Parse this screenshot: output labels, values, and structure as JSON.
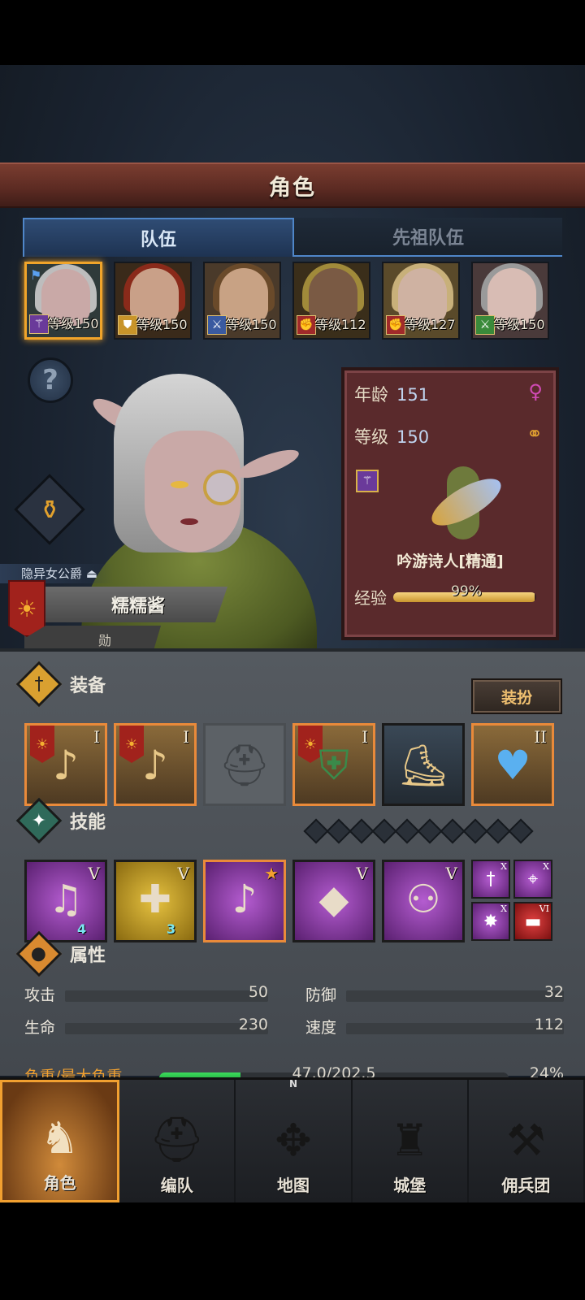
{
  "header": {
    "title": "角色"
  },
  "tabs": [
    {
      "label": "队伍",
      "active": true
    },
    {
      "label": "先祖队伍",
      "active": false
    }
  ],
  "party": [
    {
      "level_text": "等级150",
      "class_color": "#6a3a9a",
      "class_icon": "wand-icon",
      "hair": "#bdbdbd",
      "skin": "#c9a9a7",
      "bg": "#2f3a3a",
      "selected": true
    },
    {
      "level_text": "等级150",
      "class_color": "#c8942a",
      "class_icon": "shield-icon",
      "hair": "#8a2a1a",
      "skin": "#c9a088",
      "bg": "#3a2a1a",
      "selected": false
    },
    {
      "level_text": "等级150",
      "class_color": "#3a5aa0",
      "class_icon": "sword-icon",
      "hair": "#6a4a2a",
      "skin": "#c8a284",
      "bg": "#4a3a2a",
      "selected": false
    },
    {
      "level_text": "等级112",
      "class_color": "#a02a2a",
      "class_icon": "fist-icon",
      "hair": "#a08a3a",
      "skin": "#7a5a44",
      "bg": "#3a2e1a",
      "selected": false
    },
    {
      "level_text": "等级127",
      "class_color": "#a02a2a",
      "class_icon": "fist-icon",
      "hair": "#c8b07a",
      "skin": "#cfb2a2",
      "bg": "#5a4a2a",
      "selected": false
    },
    {
      "level_text": "等级150",
      "class_color": "#3a8a3a",
      "class_icon": "crossed-swords-icon",
      "hair": "#9a9a9a",
      "skin": "#d8bcb4",
      "bg": "#4a3a3a",
      "selected": false
    }
  ],
  "hero": {
    "title_tag": "隐异女公爵",
    "name": "糯糯酱",
    "sub_label": "勋",
    "age_label": "年龄",
    "age": "151",
    "level_label": "等级",
    "level": "150",
    "class_name": "吟游诗人[精通]",
    "exp_label": "经验",
    "exp_text": "99%",
    "exp_fraction": 0.99,
    "gender_icon": "female-icon",
    "status_icon": "rings-icon"
  },
  "equipment": {
    "title": "装备",
    "dress_button": "装扮",
    "slots": [
      {
        "tier": "I",
        "type": "orange",
        "icon": "lute-icon"
      },
      {
        "tier": "I",
        "type": "orange",
        "icon": "lute-icon"
      },
      {
        "tier": "",
        "type": "empty",
        "icon": "helmet-icon"
      },
      {
        "tier": "I",
        "type": "orange",
        "icon": "armor-icon"
      },
      {
        "tier": "",
        "type": "dark",
        "icon": "boots-icon"
      },
      {
        "tier": "II",
        "type": "orange",
        "icon": "amulet-icon"
      }
    ]
  },
  "skills": {
    "title": "技能",
    "gems_count": 10,
    "items": [
      {
        "tier": "V",
        "badge": "4",
        "style": "purple",
        "icon": "music-note-icon"
      },
      {
        "tier": "V",
        "badge": "3",
        "style": "gold",
        "icon": "shield-heal-icon"
      },
      {
        "tier": "★",
        "badge": "",
        "style": "purple-orange",
        "icon": "crystal-note-icon"
      },
      {
        "tier": "V",
        "badge": "",
        "style": "purple",
        "icon": "crystal-figure-icon"
      },
      {
        "tier": "V",
        "badge": "",
        "style": "purple",
        "icon": "group-icon"
      }
    ],
    "minis": [
      {
        "tier": "X",
        "style": "purple",
        "icon": "dagger-icon"
      },
      {
        "tier": "X",
        "style": "purple",
        "icon": "target-icon"
      },
      {
        "tier": "X",
        "style": "purple",
        "icon": "burst-icon"
      },
      {
        "tier": "VI",
        "style": "red",
        "icon": "dumbbell-icon"
      }
    ]
  },
  "attributes": {
    "title": "属性",
    "stats": [
      {
        "label": "攻击",
        "value": "50"
      },
      {
        "label": "防御",
        "value": "32"
      },
      {
        "label": "生命",
        "value": "230"
      },
      {
        "label": "速度",
        "value": "112"
      }
    ],
    "load_label": "负重/最大负重",
    "load_text": "47.0/202.5",
    "load_percent": "24%",
    "load_fraction": 0.232
  },
  "nav": [
    {
      "label": "角色",
      "icon": "knight-icon",
      "active": true
    },
    {
      "label": "编队",
      "icon": "helmet-icon",
      "active": false
    },
    {
      "label": "地图",
      "icon": "compass-icon",
      "active": false,
      "compass_n": "N"
    },
    {
      "label": "城堡",
      "icon": "castle-icon",
      "active": false
    },
    {
      "label": "佣兵团",
      "icon": "mercenary-icon",
      "active": false
    }
  ]
}
